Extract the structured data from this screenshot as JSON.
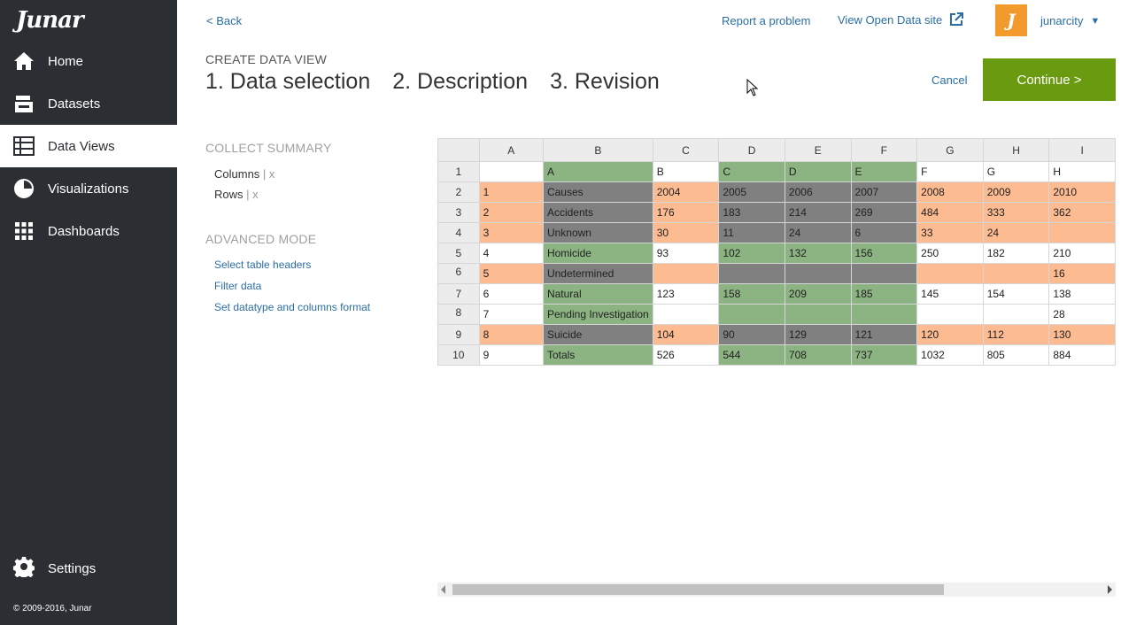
{
  "sidebar": {
    "logo_text": "Junar",
    "items": [
      {
        "label": "Home",
        "icon": "home-icon"
      },
      {
        "label": "Datasets",
        "icon": "datasets-icon"
      },
      {
        "label": "Data Views",
        "icon": "table-icon"
      },
      {
        "label": "Visualizations",
        "icon": "pie-chart-icon"
      },
      {
        "label": "Dashboards",
        "icon": "grid-icon"
      }
    ],
    "active": "Data Views",
    "settings_label": "Settings",
    "copyright": "© 2009-2016, Junar"
  },
  "header": {
    "back_label": "< Back",
    "report_label": "Report a problem",
    "open_data_label": "View Open Data site",
    "username": "junarcity",
    "avatar_letter": "J"
  },
  "wizard": {
    "create_label": "CREATE DATA VIEW",
    "steps": [
      "1. Data selection",
      "2. Description",
      "3. Revision"
    ],
    "cancel_label": "Cancel",
    "continue_label": "Continue >"
  },
  "summary": {
    "title": "COLLECT SUMMARY",
    "columns_label": "Columns",
    "rows_label": "Rows",
    "remove_mark": "| x"
  },
  "advanced": {
    "title": "ADVANCED MODE",
    "links": [
      "Select table headers",
      "Filter data",
      "Set datatype and columns format"
    ]
  },
  "colors": {
    "sidebar_bg": "#2b2f33",
    "accent_green": "#6a9a10",
    "link_blue": "#2a6ea6",
    "cell_orange": "#fdbb92",
    "cell_green": "#8cb382",
    "cell_dark": "#808080"
  },
  "grid": {
    "col_headers": [
      "A",
      "B",
      "C",
      "D",
      "E",
      "F",
      "G",
      "H",
      "I"
    ],
    "rows": [
      {
        "n": "1",
        "cells": [
          [
            "",
            "w"
          ],
          [
            "A",
            "g"
          ],
          [
            "B",
            "w"
          ],
          [
            "C",
            "g"
          ],
          [
            "D",
            "g"
          ],
          [
            "E",
            "g"
          ],
          [
            "F",
            "w"
          ],
          [
            "G",
            "w"
          ],
          [
            "H",
            "w"
          ]
        ]
      },
      {
        "n": "2",
        "cells": [
          [
            "1",
            "o"
          ],
          [
            "Causes",
            "d"
          ],
          [
            "2004",
            "o"
          ],
          [
            "2005",
            "d"
          ],
          [
            "2006",
            "d"
          ],
          [
            "2007",
            "d"
          ],
          [
            "2008",
            "o"
          ],
          [
            "2009",
            "o"
          ],
          [
            "2010",
            "o"
          ]
        ]
      },
      {
        "n": "3",
        "cells": [
          [
            "2",
            "o"
          ],
          [
            "Accidents",
            "d"
          ],
          [
            "176",
            "o"
          ],
          [
            "183",
            "d"
          ],
          [
            "214",
            "d"
          ],
          [
            "269",
            "d"
          ],
          [
            "484",
            "o"
          ],
          [
            "333",
            "o"
          ],
          [
            "362",
            "o"
          ]
        ]
      },
      {
        "n": "4",
        "cells": [
          [
            "3",
            "o"
          ],
          [
            "Unknown",
            "d"
          ],
          [
            "30",
            "o"
          ],
          [
            "11",
            "d"
          ],
          [
            "24",
            "d"
          ],
          [
            "6",
            "d"
          ],
          [
            "33",
            "o"
          ],
          [
            "24",
            "o"
          ],
          [
            "",
            "o"
          ]
        ]
      },
      {
        "n": "5",
        "cells": [
          [
            "4",
            "w"
          ],
          [
            "Homicide",
            "g"
          ],
          [
            "93",
            "w"
          ],
          [
            "102",
            "g"
          ],
          [
            "132",
            "g"
          ],
          [
            "156",
            "g"
          ],
          [
            "250",
            "w"
          ],
          [
            "182",
            "w"
          ],
          [
            "210",
            "w"
          ]
        ]
      },
      {
        "n": "6",
        "cells": [
          [
            "5",
            "o"
          ],
          [
            "Undetermined",
            "d"
          ],
          [
            "",
            "o"
          ],
          [
            "",
            "d"
          ],
          [
            "",
            "d"
          ],
          [
            "",
            "d"
          ],
          [
            "",
            "o"
          ],
          [
            "",
            "o"
          ],
          [
            "16",
            "o"
          ]
        ]
      },
      {
        "n": "7",
        "cells": [
          [
            "6",
            "w"
          ],
          [
            "Natural",
            "g"
          ],
          [
            "123",
            "w"
          ],
          [
            "158",
            "g"
          ],
          [
            "209",
            "g"
          ],
          [
            "185",
            "g"
          ],
          [
            "145",
            "w"
          ],
          [
            "154",
            "w"
          ],
          [
            "138",
            "w"
          ]
        ]
      },
      {
        "n": "8",
        "cells": [
          [
            "7",
            "w"
          ],
          [
            "Pending Investigation",
            "g"
          ],
          [
            "",
            "w"
          ],
          [
            "",
            "g"
          ],
          [
            "",
            "g"
          ],
          [
            "",
            "g"
          ],
          [
            "",
            "w"
          ],
          [
            "",
            "w"
          ],
          [
            "28",
            "w"
          ]
        ]
      },
      {
        "n": "9",
        "cells": [
          [
            "8",
            "o"
          ],
          [
            "Suicide",
            "d"
          ],
          [
            "104",
            "o"
          ],
          [
            "90",
            "d"
          ],
          [
            "129",
            "d"
          ],
          [
            "121",
            "d"
          ],
          [
            "120",
            "o"
          ],
          [
            "112",
            "o"
          ],
          [
            "130",
            "o"
          ]
        ]
      },
      {
        "n": "10",
        "cells": [
          [
            "9",
            "w"
          ],
          [
            "Totals",
            "g"
          ],
          [
            "526",
            "w"
          ],
          [
            "544",
            "g"
          ],
          [
            "708",
            "g"
          ],
          [
            "737",
            "g"
          ],
          [
            "1032",
            "w"
          ],
          [
            "805",
            "w"
          ],
          [
            "884",
            "w"
          ]
        ]
      }
    ]
  }
}
